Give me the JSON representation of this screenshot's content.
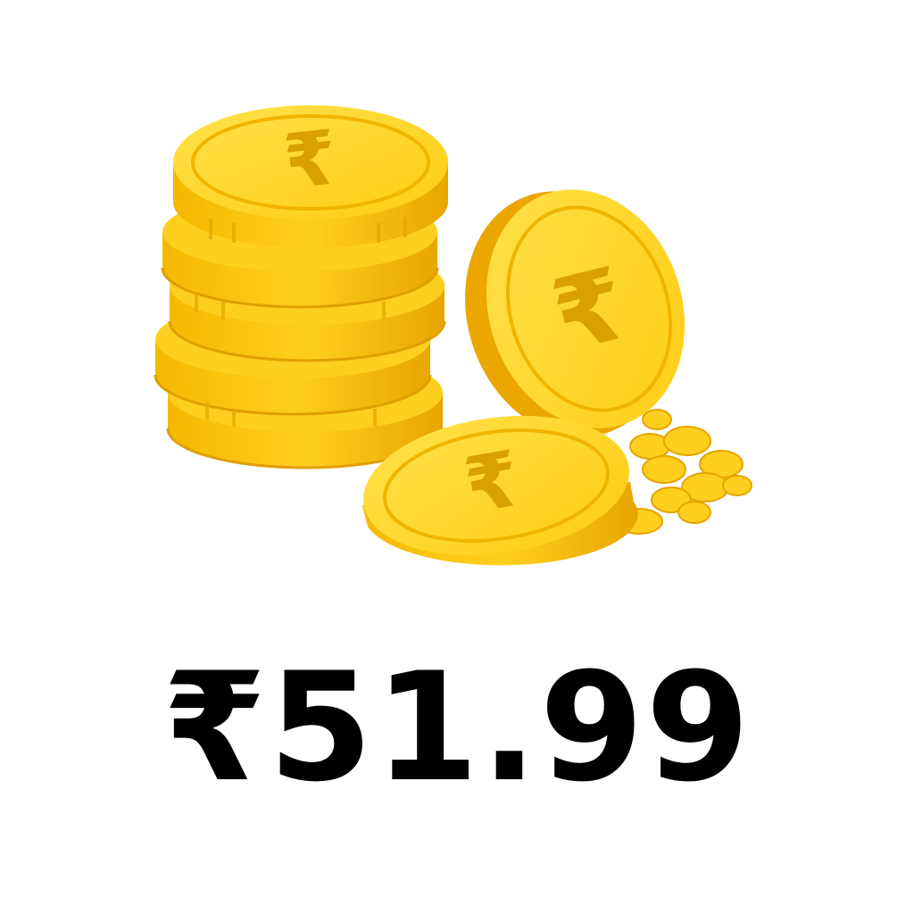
{
  "price": {
    "label": "₹51.99"
  },
  "illustration": {
    "icon": "rupee-coins-stack-icon",
    "coin_symbol": "₹",
    "colors": {
      "coin_face": "#ffd21a",
      "coin_edge": "#f2b600",
      "coin_shadow": "#e0a200",
      "symbol": "#d9a000",
      "text": "#000000",
      "background": "#ffffff"
    }
  }
}
